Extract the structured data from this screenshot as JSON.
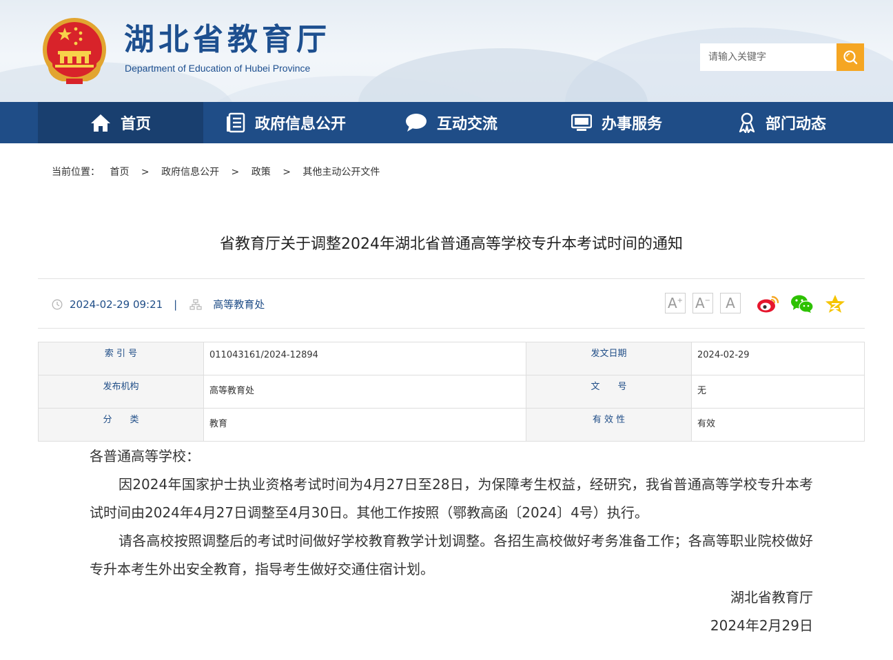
{
  "header": {
    "title": "湖北省教育厅",
    "subtitle": "Department of Education of Hubei Province",
    "search_placeholder": "请输入关键字",
    "colors": {
      "brand": "#1d4f8f",
      "nav_bg": "#1f4d87",
      "nav_active": "#193f6f",
      "search_btn": "#f5a623"
    }
  },
  "nav": {
    "items": [
      {
        "label": "首页",
        "icon": "home-icon"
      },
      {
        "label": "政府信息公开",
        "icon": "document-list-icon"
      },
      {
        "label": "互动交流",
        "icon": "chat-bubble-icon"
      },
      {
        "label": "办事服务",
        "icon": "monitor-icon"
      },
      {
        "label": "部门动态",
        "icon": "person-badge-icon"
      }
    ]
  },
  "breadcrumb": {
    "prefix": "当前位置：",
    "items": [
      "首页",
      "政府信息公开",
      "政策",
      "其他主动公开文件"
    ],
    "separator": ">"
  },
  "article": {
    "title": "省教育厅关于调整2024年湖北省普通高等学校专升本考试时间的通知",
    "datetime": "2024-02-29 09:21",
    "divider": "|",
    "source": "高等教育处",
    "font_buttons": [
      "A",
      "A",
      "A"
    ]
  },
  "share": [
    "weibo-icon",
    "wechat-icon",
    "favorite-star-icon"
  ],
  "meta": {
    "rows": [
      {
        "k1": "索 引 号",
        "v1": "011043161/2024-12894",
        "k2": "发文日期",
        "v2": "2024-02-29"
      },
      {
        "k1": "发布机构",
        "v1": "高等教育处",
        "k2": "文　　号",
        "v2": "无"
      },
      {
        "k1": "分　　类",
        "v1": "教育",
        "k2": "有 效 性",
        "v2": "有效"
      }
    ]
  },
  "body": {
    "salutation": "各普通高等学校：",
    "p1": "因2024年国家护士执业资格考试时间为4月27日至28日，为保障考生权益，经研究，我省普通高等学校专升本考试时间由2024年4月27日调整至4月30日。其他工作按照（鄂教高函〔2024〕4号）执行。",
    "p2": "请各高校按照调整后的考试时间做好学校教育教学计划调整。各招生高校做好考务准备工作；各高等职业院校做好专升本考生外出安全教育，指导考生做好交通住宿计划。",
    "signature": "湖北省教育厅",
    "date": "2024年2月29日"
  }
}
